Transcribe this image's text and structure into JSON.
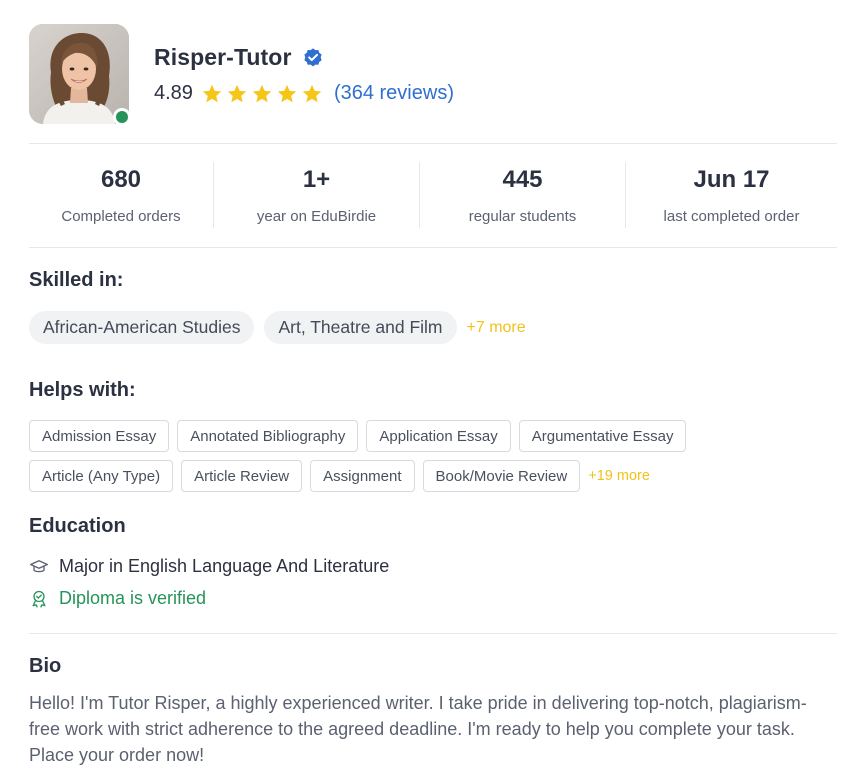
{
  "profile": {
    "name": "Risper-Tutor",
    "rating": "4.89",
    "stars": 5,
    "reviews": "(364 reviews)",
    "online": true
  },
  "stats": [
    {
      "value": "680",
      "label": "Completed orders"
    },
    {
      "value": "1+",
      "label": "year on EduBirdie"
    },
    {
      "value": "445",
      "label": "regular students"
    },
    {
      "value": "Jun 17",
      "label": "last completed order"
    }
  ],
  "skilled": {
    "title": "Skilled in:",
    "items": [
      "African-American Studies",
      "Art, Theatre and Film"
    ],
    "more": "+7 more"
  },
  "helps": {
    "title": "Helps with:",
    "row1": [
      "Admission Essay",
      "Annotated Bibliography",
      "Application Essay",
      "Argumentative Essay"
    ],
    "row2": [
      "Article (Any Type)",
      "Article Review",
      "Assignment",
      "Book/Movie Review"
    ],
    "more": "+19 more"
  },
  "education": {
    "title": "Education",
    "major": "Major in English Language And Literature",
    "diploma": "Diploma is verified"
  },
  "bio": {
    "title": "Bio",
    "text": "Hello! I'm Tutor Risper, a highly experienced writer. I take pride in delivering top-notch, plagiarism-free work with strict adherence to the agreed deadline. I'm ready to help you complete your task. Place your order now!"
  },
  "colors": {
    "accent_blue": "#2f6fd0",
    "star": "#f5c518",
    "more_link": "#f2c21a",
    "verified_green": "#27935a",
    "online_dot": "#27935a"
  }
}
